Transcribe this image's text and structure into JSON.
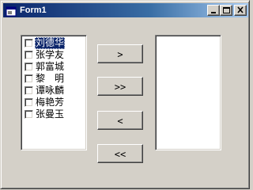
{
  "window": {
    "title": "Form1",
    "icon": "form-app-icon",
    "controls": [
      "minimize-icon",
      "maximize-icon",
      "close-icon"
    ]
  },
  "left_list": {
    "items": [
      {
        "label": "刘德华",
        "checked": false,
        "selected": true
      },
      {
        "label": "张学友",
        "checked": false,
        "selected": false
      },
      {
        "label": "郭富城",
        "checked": false,
        "selected": false
      },
      {
        "label": "黎　明",
        "checked": false,
        "selected": false
      },
      {
        "label": "谭咏麟",
        "checked": false,
        "selected": false
      },
      {
        "label": "梅艳芳",
        "checked": false,
        "selected": false
      },
      {
        "label": "张曼玉",
        "checked": false,
        "selected": false
      }
    ]
  },
  "right_list": {
    "items": []
  },
  "buttons": {
    "move_right": ">",
    "move_all_right": ">>",
    "move_left": "<",
    "move_all_left": "<<"
  },
  "colors": {
    "face": "#d4d0c8",
    "title_start": "#0a246a",
    "title_end": "#a6caf0",
    "selection": "#0a246a"
  }
}
